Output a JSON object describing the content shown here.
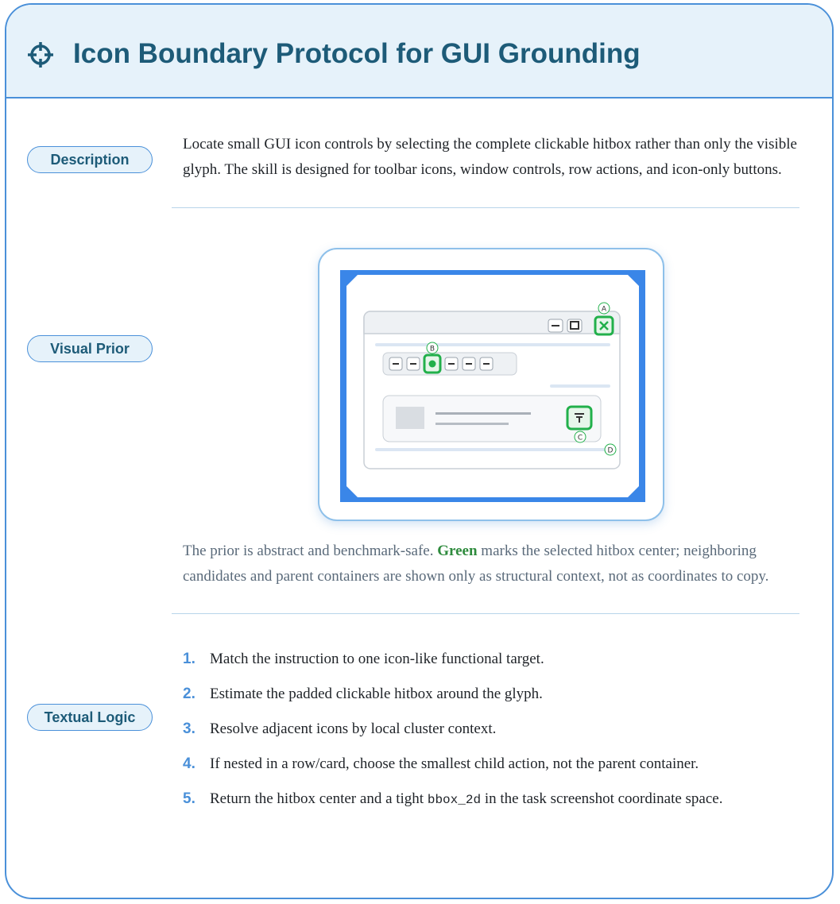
{
  "title": "Icon Boundary Protocol for GUI Grounding",
  "header_icon": "crosshair-icon",
  "sections": {
    "description": {
      "label": "Description",
      "text": "Locate small GUI icon controls by selecting the complete clickable hitbox rather than only the visible glyph. The skill is designed for toolbar icons, window controls, row actions, and icon-only buttons."
    },
    "visual_prior": {
      "label": "Visual Prior",
      "figure": {
        "markers": [
          "A",
          "B",
          "C",
          "D"
        ],
        "highlight_color": "#22b04b"
      },
      "caption_prefix": "The prior is abstract and benchmark-safe. ",
      "caption_bold": "Green",
      "caption_suffix": " marks the selected hitbox center; neighboring candidates and parent containers are shown only as structural context, not as coordinates to copy."
    },
    "textual_logic": {
      "label": "Textual Logic",
      "steps": [
        {
          "num": "1.",
          "text": "Match the instruction to one icon-like functional target."
        },
        {
          "num": "2.",
          "text": "Estimate the padded clickable hitbox around the glyph."
        },
        {
          "num": "3.",
          "text": "Resolve adjacent icons by local cluster context."
        },
        {
          "num": "4.",
          "text": "If nested in a row/card, choose the smallest child action, not the parent container."
        },
        {
          "num": "5.",
          "pre": "Return the hitbox center and a tight ",
          "code": "bbox_2d",
          "post": " in the task screenshot coordinate space."
        }
      ]
    }
  },
  "colors": {
    "accent": "#4a90d9",
    "title": "#1d5b78",
    "highlight": "#22b04b",
    "header_bg": "#e6f2fa"
  }
}
